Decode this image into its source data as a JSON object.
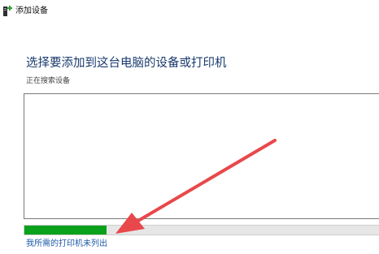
{
  "window": {
    "title": "添加设备",
    "icon": "add-device-icon"
  },
  "main": {
    "heading": "选择要添加到这台电脑的设备或打印机",
    "status": "正在搜索设备",
    "device_list": [],
    "progress": 0.23,
    "not_listed_link": "我所需的打印机未列出"
  },
  "annotation": {
    "icon": "red-arrow-icon",
    "color": "#e8484b"
  },
  "colors": {
    "progress_fill": "#0aa11b",
    "heading": "#1a3a6e",
    "link": "#1e5aa8"
  }
}
